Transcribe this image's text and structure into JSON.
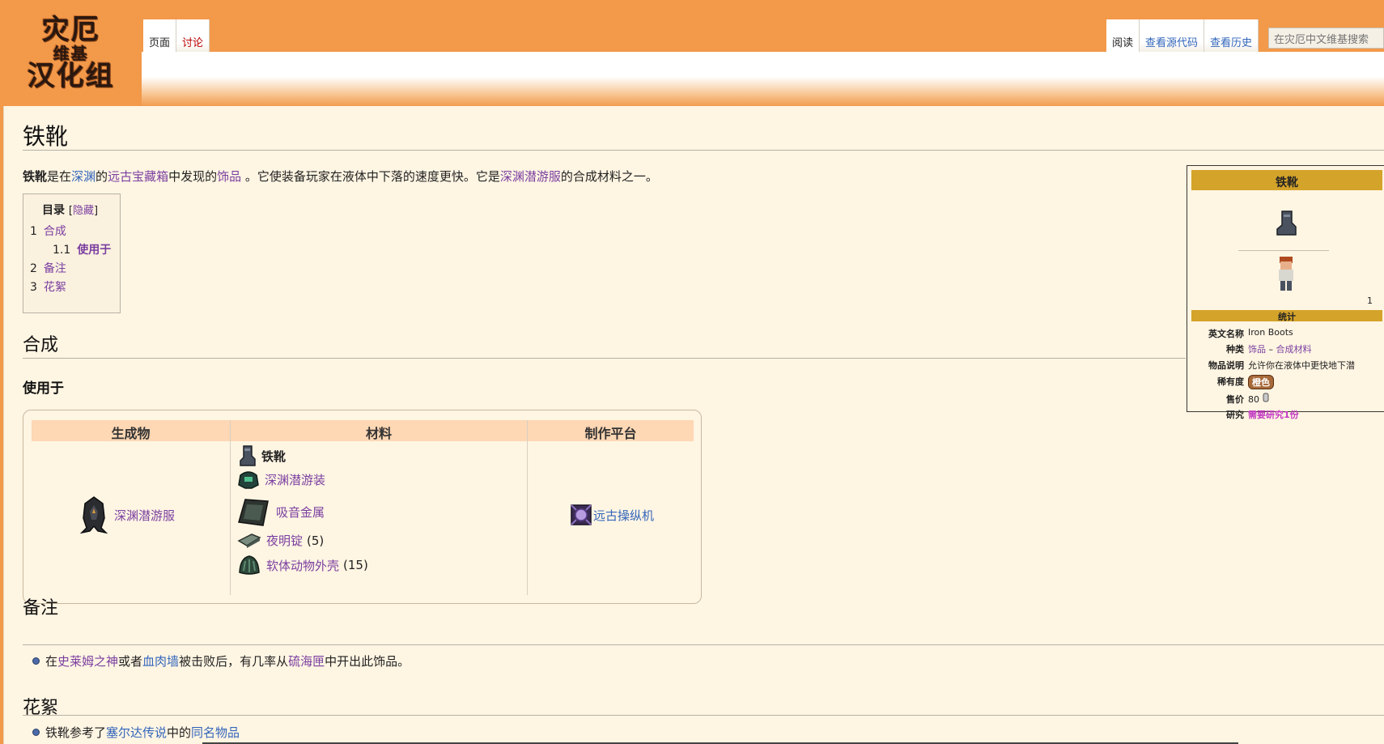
{
  "logo": {
    "line1": "灾厄",
    "line2": "维基",
    "line3": "汉化组"
  },
  "tabs_left": [
    {
      "label": "页面",
      "selected": true
    },
    {
      "label": "讨论",
      "selected": false
    }
  ],
  "tabs_right": [
    {
      "label": "阅读",
      "selected": true
    },
    {
      "label": "查看源代码",
      "selected": false
    },
    {
      "label": "查看历史",
      "selected": false
    }
  ],
  "search": {
    "placeholder": "在灾厄中文维基搜索"
  },
  "page": {
    "title": "铁靴",
    "intro": {
      "bold": "铁靴",
      "t1": "是在",
      "l1": "深渊",
      "t2": "的",
      "l2": "远古宝藏箱",
      "t3": "中发现的",
      "l3": "饰品",
      "t4": " 。它使装备玩家在液体中下落的速度更快。它是",
      "l4": "深渊潜游服",
      "t5": "的合成材料之一。"
    }
  },
  "toc": {
    "title": "目录",
    "toggle_open": "[",
    "toggle_label": "隐藏",
    "toggle_close": "]",
    "items": [
      {
        "num": "1",
        "label": "合成"
      },
      {
        "num": "1.1",
        "label": "使用于"
      },
      {
        "num": "2",
        "label": "备注"
      },
      {
        "num": "3",
        "label": "花絮"
      }
    ]
  },
  "sections": {
    "crafting": "合成",
    "used_in": "使用于",
    "notes": "备注",
    "trivia": "花絮"
  },
  "recipe": {
    "headers": [
      "生成物",
      "材料",
      "制作平台"
    ],
    "result": "深渊潜游服",
    "ingredients": [
      {
        "name": "铁靴",
        "qty": ""
      },
      {
        "name": "深渊潜游装",
        "qty": ""
      },
      {
        "name": "吸音金属",
        "qty": ""
      },
      {
        "name": "夜明锭",
        "qty": "(5)"
      },
      {
        "name": "软体动物外壳",
        "qty": "(15)"
      }
    ],
    "station": "远古操纵机"
  },
  "notes": {
    "t1": "在",
    "l1": "史莱姆之神",
    "t2": "或者",
    "l2": "血肉墙",
    "t3": "被击败后，有几率从",
    "l3": "硫海匣",
    "t4": "中开出此饰品。"
  },
  "trivia": {
    "t1": "铁靴参考了",
    "l1": "塞尔达传说",
    "t2": "中的",
    "l2": "同名物品"
  },
  "infobox": {
    "title": "铁靴",
    "stack": "1",
    "stats_header": "统计",
    "rows": {
      "english_key": "英文名称",
      "english_val": "Iron Boots",
      "type_key": "种类",
      "type_val1": "饰品",
      "type_dash": " – ",
      "type_val2": "合成材料",
      "tooltip_key": "物品说明",
      "tooltip_val": "允许你在液体中更快地下潜",
      "rarity_key": "稀有度",
      "rarity_val": "橙色",
      "sell_key": "售价",
      "sell_val": "80",
      "research_key": "研究",
      "research_val": "需要研究1份"
    }
  },
  "colors": {
    "header_orange": "#f2994a",
    "content_bg": "#fff5e3",
    "infobox_gold": "#d4a32a",
    "table_header": "#fed7b4",
    "link_purple": "#7a3fa0",
    "link_blue": "#3366bb"
  }
}
